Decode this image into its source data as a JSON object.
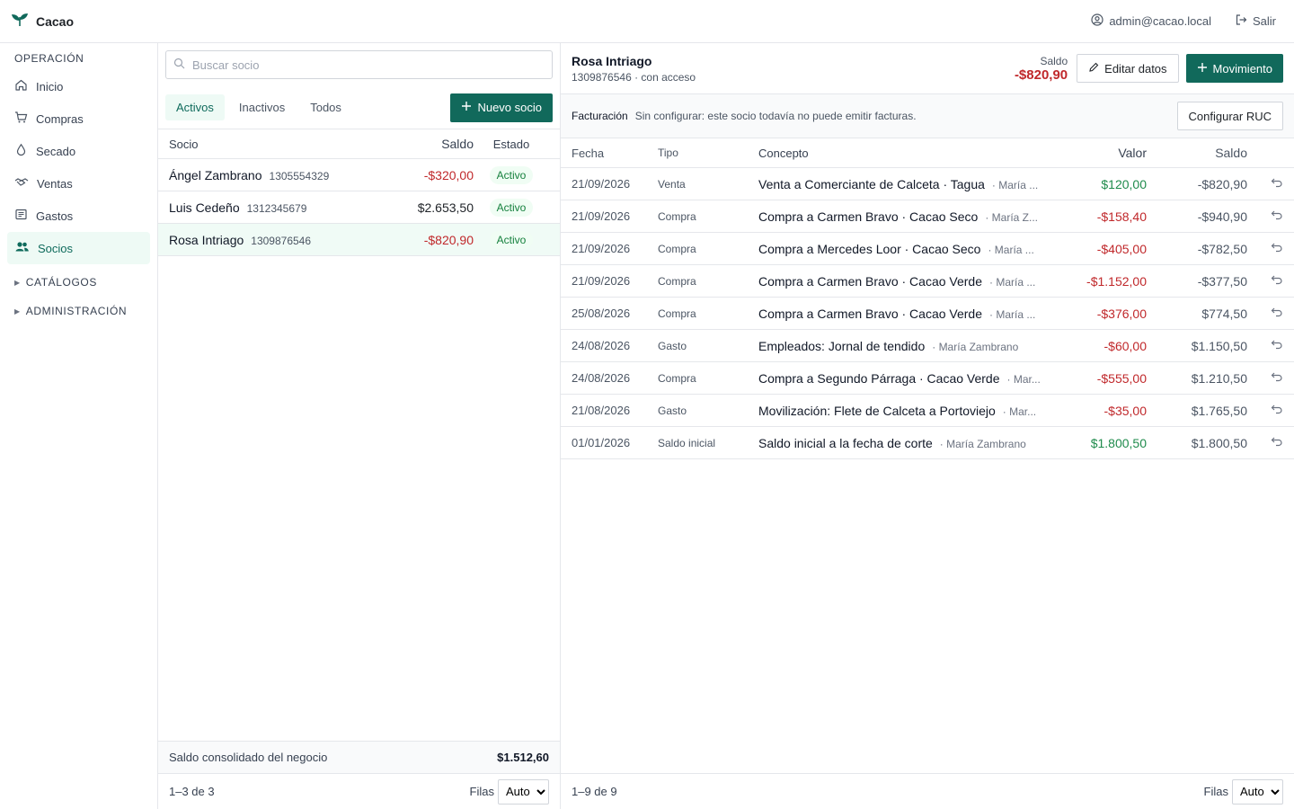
{
  "app": {
    "name": "Cacao"
  },
  "topbar": {
    "user": "admin@cacao.local",
    "logout": "Salir"
  },
  "sidebar": {
    "section": "OPERACIÓN",
    "items": [
      {
        "label": "Inicio",
        "icon": "home-icon"
      },
      {
        "label": "Compras",
        "icon": "cart-icon"
      },
      {
        "label": "Secado",
        "icon": "drop-icon"
      },
      {
        "label": "Ventas",
        "icon": "handshake-icon"
      },
      {
        "label": "Gastos",
        "icon": "receipt-icon"
      },
      {
        "label": "Socios",
        "icon": "users-icon",
        "active": true
      }
    ],
    "groups": [
      "CATÁLOGOS",
      "ADMINISTRACIÓN"
    ]
  },
  "list": {
    "search_placeholder": "Buscar socio",
    "tabs": [
      "Activos",
      "Inactivos",
      "Todos"
    ],
    "new_button": "Nuevo socio",
    "headers": {
      "socio": "Socio",
      "saldo": "Saldo",
      "estado": "Estado"
    },
    "rows": [
      {
        "name": "Ángel Zambrano",
        "id": "1305554329",
        "saldo": "-$320,00",
        "estado": "Activo"
      },
      {
        "name": "Luis Cedeño",
        "id": "1312345679",
        "saldo": "$2.653,50",
        "estado": "Activo"
      },
      {
        "name": "Rosa Intriago",
        "id": "1309876546",
        "saldo": "-$820,90",
        "estado": "Activo"
      }
    ],
    "consolidated_label": "Saldo consolidado del negocio",
    "consolidated_value": "$1.512,60",
    "pagination": "1–3 de 3",
    "rows_label": "Filas",
    "rows_value": "Auto"
  },
  "detail": {
    "name": "Rosa Intriago",
    "sub": "1309876546 · con acceso",
    "saldo_label": "Saldo",
    "saldo_value": "-$820,90",
    "edit_button": "Editar datos",
    "movement_button": "Movimiento",
    "billing_title": "Facturación",
    "billing_text": "Sin configurar: este socio todavía no puede emitir facturas.",
    "billing_button": "Configurar RUC",
    "headers": {
      "fecha": "Fecha",
      "tipo": "Tipo",
      "concepto": "Concepto",
      "valor": "Valor",
      "saldo": "Saldo"
    },
    "movements": [
      {
        "fecha": "21/09/2026",
        "tipo": "Venta",
        "concepto": "Venta a Comerciante de Calceta · Tagua",
        "by": "· María ...",
        "valor": "$120,00",
        "sign": "pos",
        "saldo": "-$820,90"
      },
      {
        "fecha": "21/09/2026",
        "tipo": "Compra",
        "concepto": "Compra a Carmen Bravo · Cacao Seco",
        "by": "· María Z...",
        "valor": "-$158,40",
        "sign": "neg",
        "saldo": "-$940,90"
      },
      {
        "fecha": "21/09/2026",
        "tipo": "Compra",
        "concepto": "Compra a Mercedes Loor · Cacao Seco",
        "by": "· María ...",
        "valor": "-$405,00",
        "sign": "neg",
        "saldo": "-$782,50"
      },
      {
        "fecha": "21/09/2026",
        "tipo": "Compra",
        "concepto": "Compra a Carmen Bravo · Cacao Verde",
        "by": "· María ...",
        "valor": "-$1.152,00",
        "sign": "neg",
        "saldo": "-$377,50"
      },
      {
        "fecha": "25/08/2026",
        "tipo": "Compra",
        "concepto": "Compra a Carmen Bravo · Cacao Verde",
        "by": "· María ...",
        "valor": "-$376,00",
        "sign": "neg",
        "saldo": "$774,50"
      },
      {
        "fecha": "24/08/2026",
        "tipo": "Gasto",
        "concepto": "Empleados: Jornal de tendido",
        "by": "· María Zambrano",
        "valor": "-$60,00",
        "sign": "neg",
        "saldo": "$1.150,50"
      },
      {
        "fecha": "24/08/2026",
        "tipo": "Compra",
        "concepto": "Compra a Segundo Párraga · Cacao Verde",
        "by": "· Mar...",
        "valor": "-$555,00",
        "sign": "neg",
        "saldo": "$1.210,50"
      },
      {
        "fecha": "21/08/2026",
        "tipo": "Gasto",
        "concepto": "Movilización: Flete de Calceta a Portoviejo",
        "by": "· Mar...",
        "valor": "-$35,00",
        "sign": "neg",
        "saldo": "$1.765,50"
      },
      {
        "fecha": "01/01/2026",
        "tipo": "Saldo inicial",
        "concepto": "Saldo inicial a la fecha de corte",
        "by": "· María Zambrano",
        "valor": "$1.800,50",
        "sign": "pos",
        "saldo": "$1.800,50"
      }
    ],
    "pagination": "1–9 de 9",
    "rows_label": "Filas",
    "rows_value": "Auto"
  },
  "colors": {
    "accent": "#11695b",
    "negative": "#c0282b",
    "positive": "#1f8b4c"
  }
}
